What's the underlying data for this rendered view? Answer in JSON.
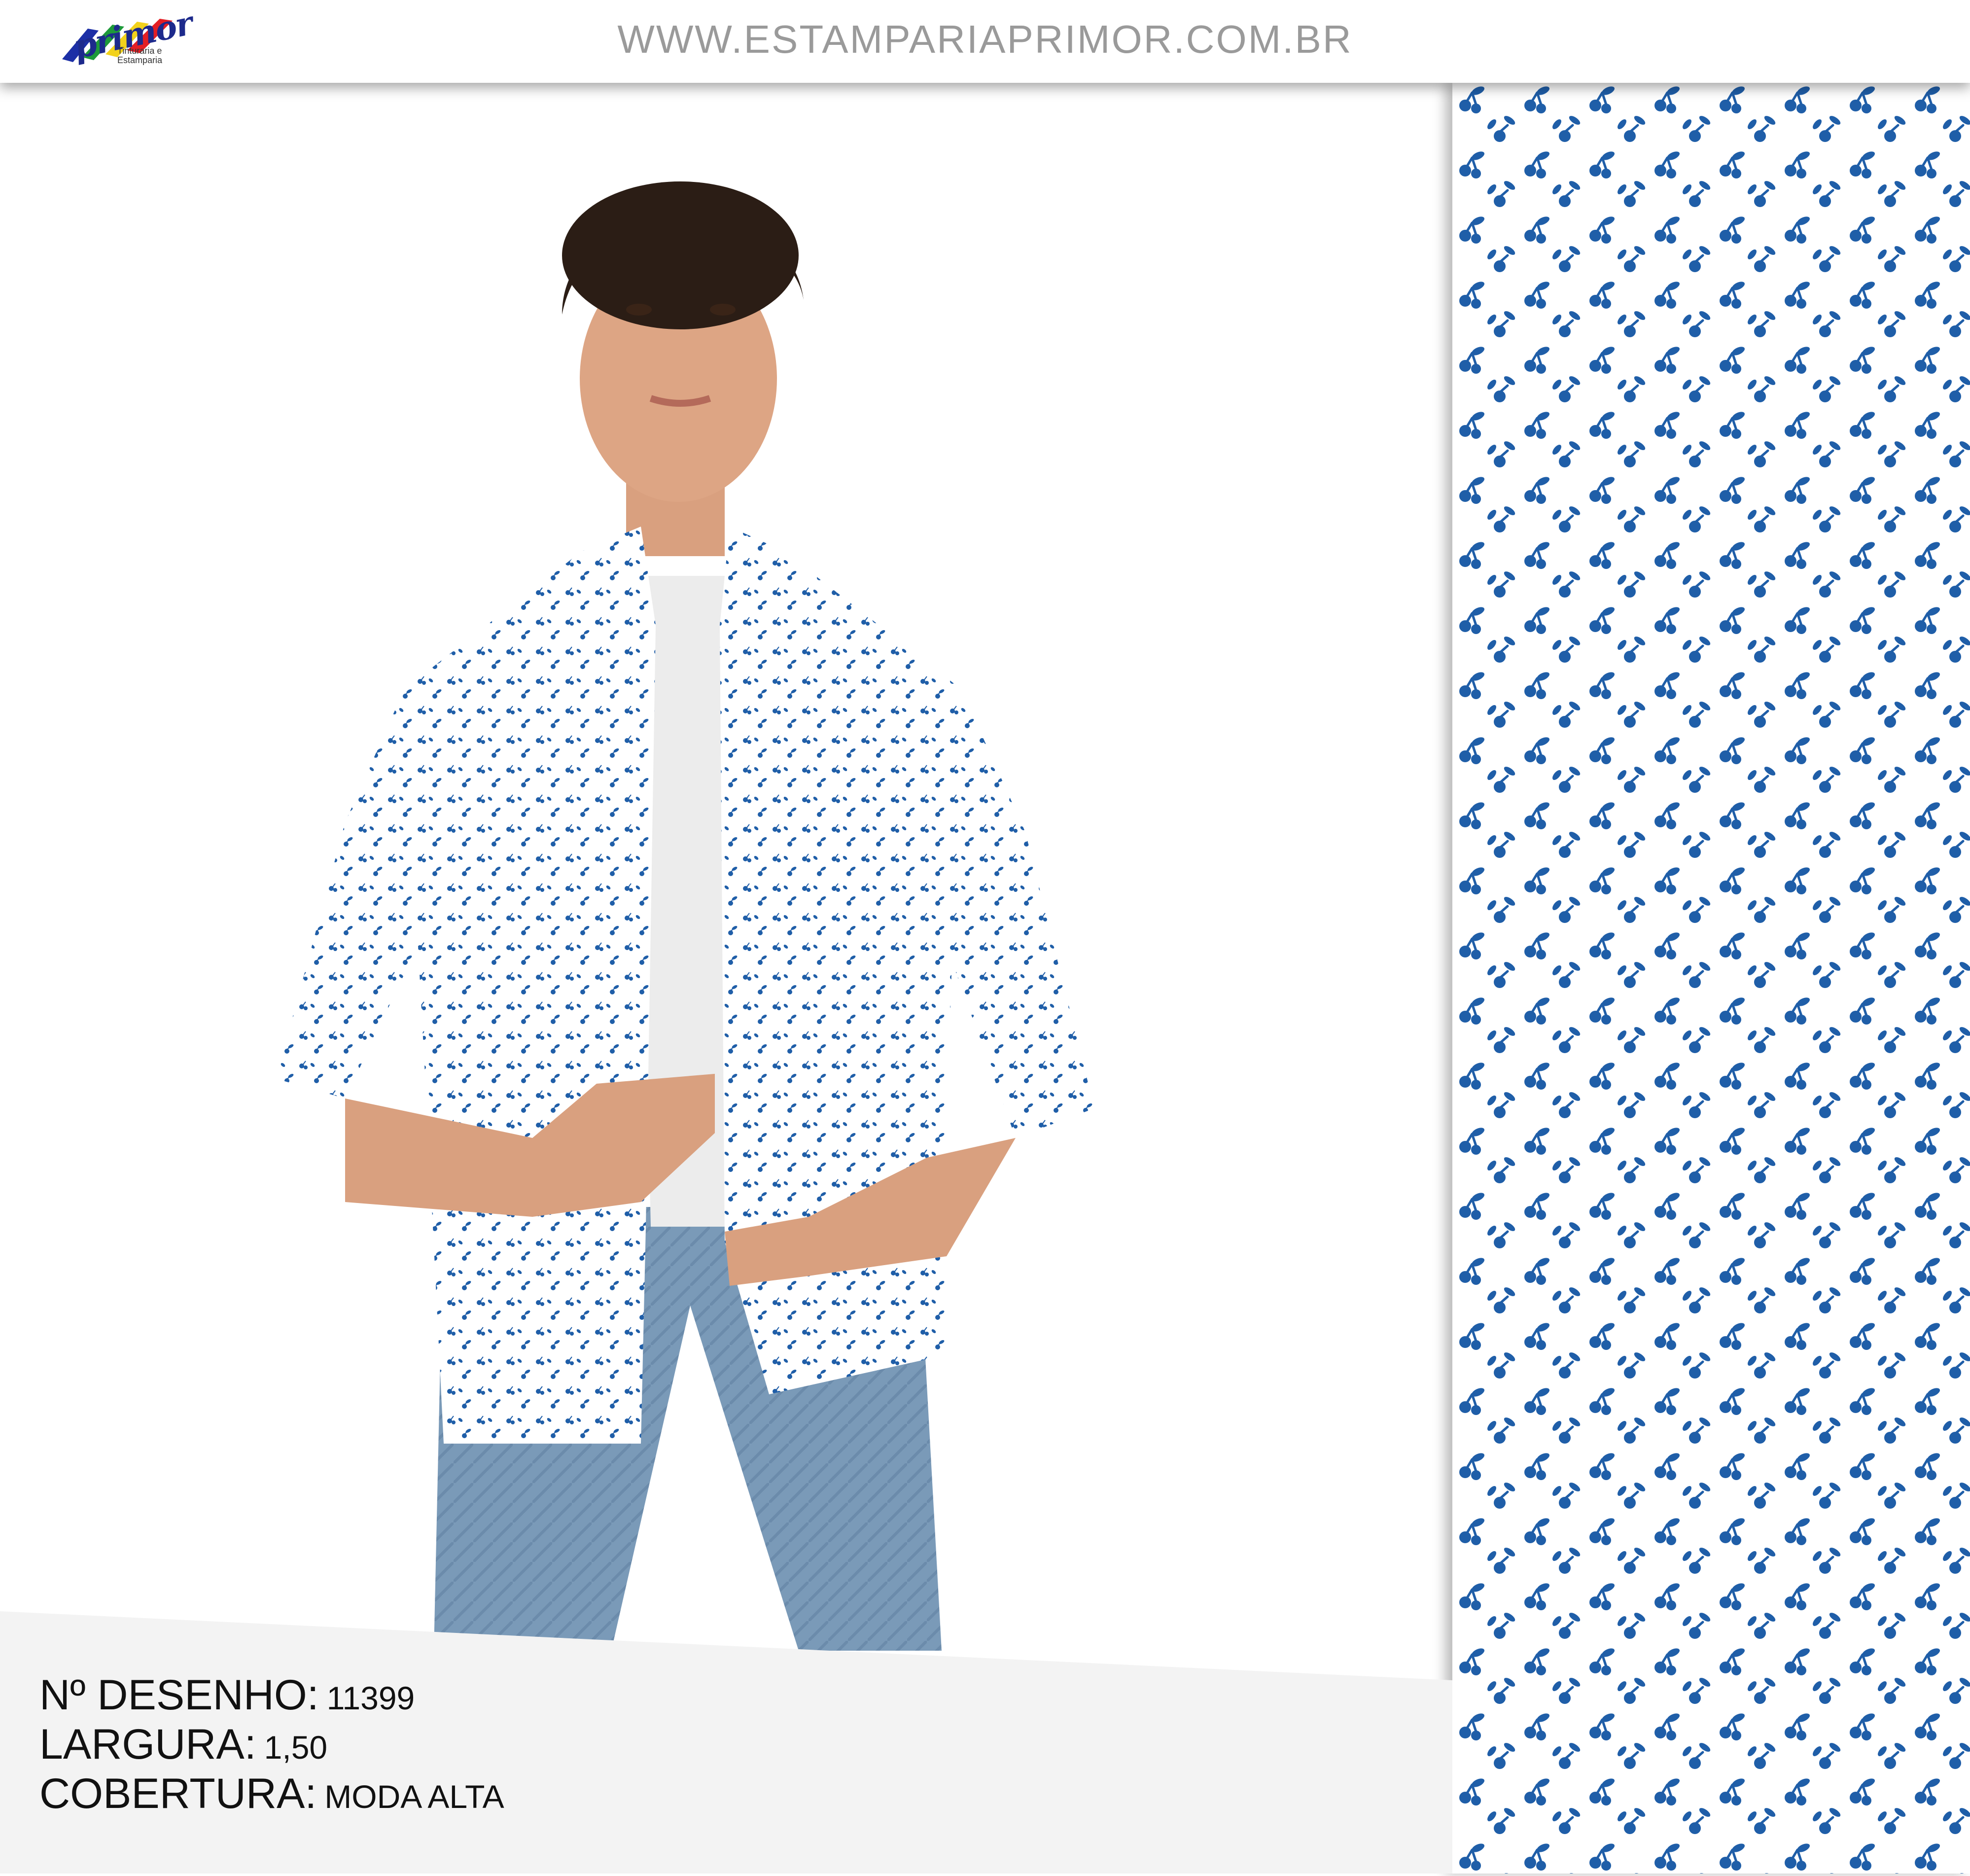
{
  "header": {
    "logo": {
      "word": "primor",
      "tagline": "Tinturaria e Estamparia",
      "stripe_colors": [
        "#1c2fa6",
        "#1e9a3a",
        "#f2d21b",
        "#e31e24"
      ]
    },
    "site_url": "WWW.ESTAMPARIAPRIMOR.COM.BR"
  },
  "model": {
    "description_icon": "model-wearing-printed-shirt"
  },
  "info": {
    "desenho_label": "Nº DESENHO:",
    "desenho_value": "11399",
    "largura_label": "LARGURA:",
    "largura_value": "1,50",
    "cobertura_label": "COBERTURA:",
    "cobertura_value": "MODA ALTA"
  },
  "pattern": {
    "background": "#ffffff",
    "motif_color": "#1f5ea8",
    "motif": "cherry-and-leaf-icon"
  }
}
